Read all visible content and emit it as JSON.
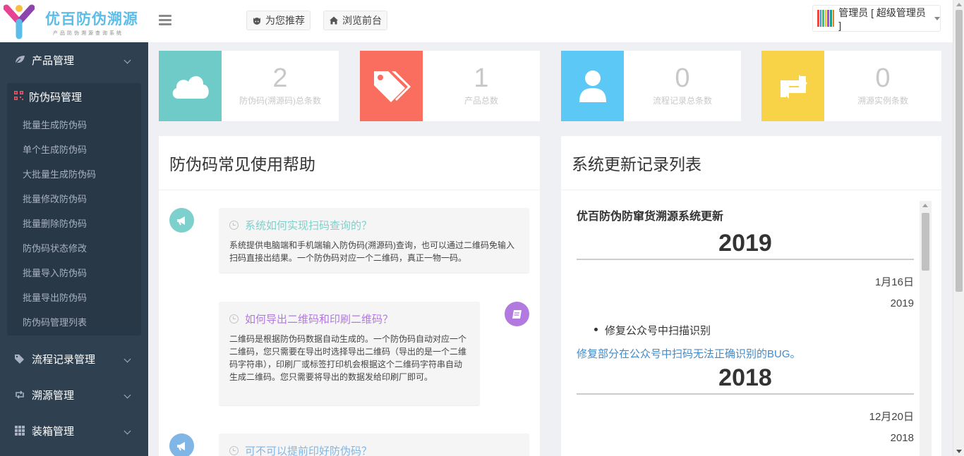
{
  "header": {
    "logo_title": "优百防伪溯源",
    "logo_subtitle": "产品防伪溯源查询系统",
    "recommend_label": "为您推荐",
    "browse_label": "浏览前台",
    "user_label": "管理员 [ 超级管理员 ]"
  },
  "sidebar": {
    "items": [
      {
        "label": "产品管理",
        "icon": "leaf-icon"
      },
      {
        "label": "防伪码管理",
        "icon": "qrcode-icon"
      },
      {
        "label": "流程记录管理",
        "icon": "tags-icon"
      },
      {
        "label": "溯源管理",
        "icon": "retweet-icon"
      },
      {
        "label": "装箱管理",
        "icon": "grid-icon"
      }
    ],
    "sub_items": [
      "批量生成防伪码",
      "单个生成防伪码",
      "大批量生成防伪码",
      "批量修改防伪码",
      "批量删除防伪码",
      "防伪码状态修改",
      "批量导入防伪码",
      "批量导出防伪码",
      "防伪码管理列表"
    ]
  },
  "stats": [
    {
      "value": "2",
      "label": "防伪码(溯源码)总条数",
      "color": "#6ecbc8",
      "icon": "cloud-icon"
    },
    {
      "value": "1",
      "label": "产品总数",
      "color": "#fa6e5f",
      "icon": "tags-icon"
    },
    {
      "value": "0",
      "label": "流程记录总条数",
      "color": "#5bc8f5",
      "icon": "user-icon"
    },
    {
      "value": "0",
      "label": "溯源实例条数",
      "color": "#f8d247",
      "icon": "retweet-icon"
    }
  ],
  "faq": {
    "title": "防伪码常见使用帮助",
    "items": [
      {
        "question": "系统如何实现扫码查询的？",
        "answer": "系统提供电脑端和手机端输入防伪码(溯源码)查询，也可以通过二维码免输入扫码直接出结果。一个防伪码对应一个二维码，真正一物一码。",
        "color": "#7ed0cd"
      },
      {
        "question": "如何导出二维码和印刷二维码？",
        "answer": "二维码是根据防伪码数据自动生成的。一个防伪码自动对应一个二维码，您只需要在导出时选择导出二维码（导出的是一个二维码字符串），印刷厂或标签打印机会根据这个二维码字符串自动生成二维码。您只需要将导出的数据发给印刷厂即可。",
        "color": "#b279e0"
      },
      {
        "question": "可不可以提前印好防伪码？",
        "answer": "",
        "color": "#7fb6e6"
      }
    ]
  },
  "updates": {
    "title": "系统更新记录列表",
    "heading": "优百防伪防窜货溯源系统更新",
    "years": [
      {
        "year": "2019",
        "date": "1月16日",
        "date_year": "2019",
        "item": "修复公众号中扫描识别",
        "link": "修复部分在公众号中扫码无法正确识别的BUG。"
      },
      {
        "year": "2018",
        "date": "12月20日",
        "date_year": "2018"
      }
    ]
  }
}
